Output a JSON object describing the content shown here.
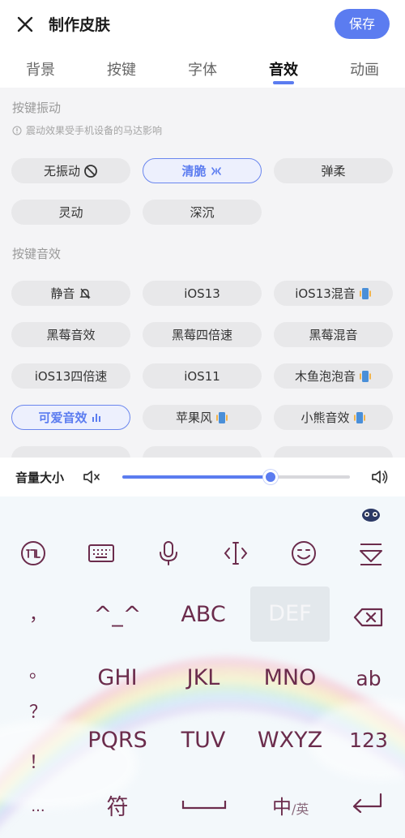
{
  "header": {
    "title": "制作皮肤",
    "save_label": "保存"
  },
  "tabs": [
    {
      "label": "背景",
      "active": false
    },
    {
      "label": "按键",
      "active": false
    },
    {
      "label": "字体",
      "active": false
    },
    {
      "label": "音效",
      "active": true
    },
    {
      "label": "动画",
      "active": false
    }
  ],
  "vibration": {
    "title": "按键振动",
    "hint": "震动效果受手机设备的马达影响",
    "options": [
      {
        "label": "无振动",
        "icon": "no-vibration-icon",
        "selected": false
      },
      {
        "label": "清脆",
        "icon": "crisp-vibration-icon",
        "selected": true
      },
      {
        "label": "弹柔",
        "icon": "",
        "selected": false
      },
      {
        "label": "灵动",
        "icon": "",
        "selected": false
      },
      {
        "label": "深沉",
        "icon": "",
        "selected": false
      }
    ]
  },
  "sound": {
    "title": "按键音效",
    "options": [
      {
        "label": "静音",
        "icon": "mute-bell-icon",
        "selected": false
      },
      {
        "label": "iOS13",
        "icon": "",
        "selected": false
      },
      {
        "label": "iOS13混音",
        "icon": "vibrate-phone-icon",
        "selected": false
      },
      {
        "label": "黑莓音效",
        "icon": "",
        "selected": false
      },
      {
        "label": "黑莓四倍速",
        "icon": "",
        "selected": false
      },
      {
        "label": "黑莓混音",
        "icon": "",
        "selected": false
      },
      {
        "label": "iOS13四倍速",
        "icon": "",
        "selected": false
      },
      {
        "label": "iOS11",
        "icon": "",
        "selected": false
      },
      {
        "label": "木鱼泡泡音",
        "icon": "vibrate-phone-icon",
        "selected": false
      },
      {
        "label": "可爱音效",
        "icon": "sound-bars-icon",
        "selected": true
      },
      {
        "label": "苹果风",
        "icon": "vibrate-phone-icon",
        "selected": false
      },
      {
        "label": "小熊音效",
        "icon": "vibrate-phone-icon",
        "selected": false
      }
    ]
  },
  "volume": {
    "label": "音量大小",
    "level_fraction": 0.65
  },
  "keyboard": {
    "row1": {
      "punct": "，",
      "k1": "^_^",
      "k2": "ABC",
      "k3": "DEF"
    },
    "row2": {
      "punct": "。",
      "k1": "GHI",
      "k2": "JKL",
      "k3": "MNO",
      "side": "ab"
    },
    "row3": {
      "punct": "？",
      "k1": "PQRS",
      "k2": "TUV",
      "k3": "WXYZ",
      "side": "123"
    },
    "row4": {
      "punct": "！",
      "ellipsis": "...",
      "symbol": "符",
      "zh": "中",
      "en": "/英"
    }
  },
  "colors": {
    "accent": "#5b7cf0",
    "key_text": "#6b2c4c",
    "panel_bg": "#f4f4f6",
    "chip_bg": "#e8e8ea"
  }
}
